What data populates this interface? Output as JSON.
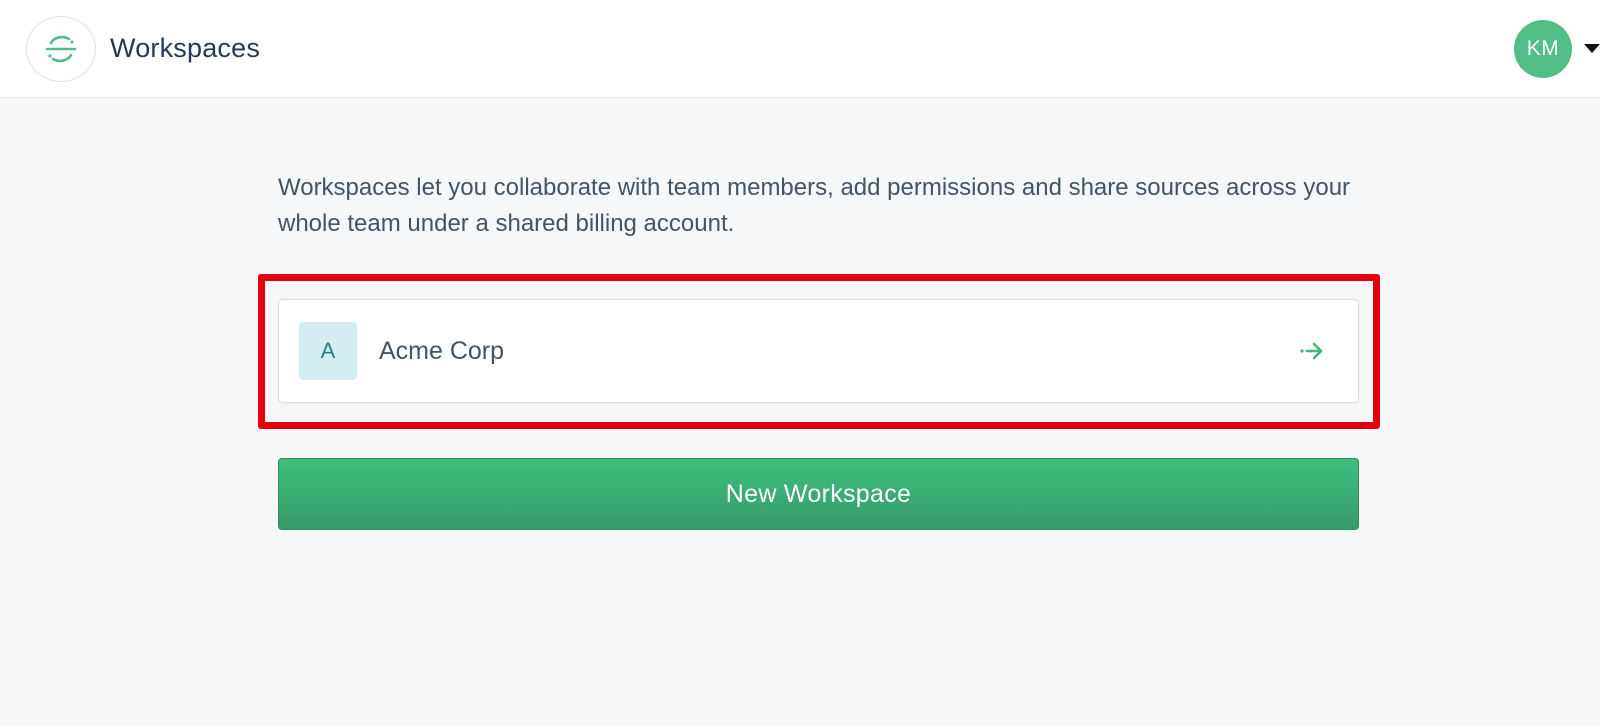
{
  "header": {
    "logo_icon": "segment-logo-icon",
    "title": "Workspaces",
    "user_initials": "KM",
    "menu_icon": "caret-down-icon"
  },
  "main": {
    "intro": "Workspaces let you collaborate with team members, add permissions and share sources across your whole team under a shared billing account.",
    "workspaces": [
      {
        "initial": "A",
        "name": "Acme Corp",
        "arrow_icon": "arrow-right-icon"
      }
    ],
    "new_workspace_label": "New Workspace"
  },
  "colors": {
    "brand_green": "#52bd85",
    "button_green": "#3cbf7c",
    "highlight_red": "#e3010f",
    "badge_bg": "#d3edf2"
  }
}
